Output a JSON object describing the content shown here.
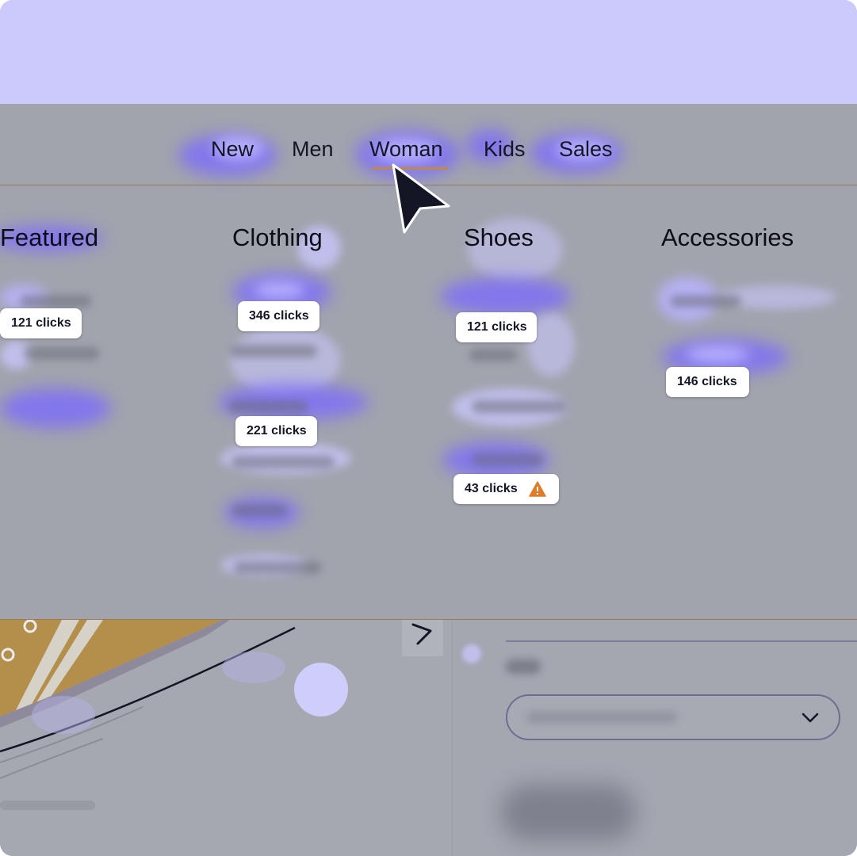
{
  "nav": {
    "items": [
      {
        "label": "New"
      },
      {
        "label": "Men"
      },
      {
        "label": "Woman"
      },
      {
        "label": "Kids"
      },
      {
        "label": "Sales"
      }
    ],
    "active": "Woman"
  },
  "menu": {
    "columns": [
      {
        "heading": "Featured"
      },
      {
        "heading": "Clothing"
      },
      {
        "heading": "Shoes"
      },
      {
        "heading": "Accessories"
      }
    ]
  },
  "badges": [
    {
      "text": "121 clicks"
    },
    {
      "text": "346 clicks"
    },
    {
      "text": "221 clicks"
    },
    {
      "text": "121 clicks"
    },
    {
      "text": "43 clicks",
      "warning": true
    },
    {
      "text": "146 clicks"
    }
  ],
  "icons": {
    "cursor": "pointer-cursor-icon",
    "warning": "warning-icon",
    "chevron": "chevron-down-icon",
    "next": "chevron-right-icon"
  },
  "colors": {
    "top_band": "#cccafc",
    "overlay": "#a1a3ad",
    "heat": "#7d6ff7",
    "underline": "#c0884e",
    "warning": "#e07b2a"
  }
}
